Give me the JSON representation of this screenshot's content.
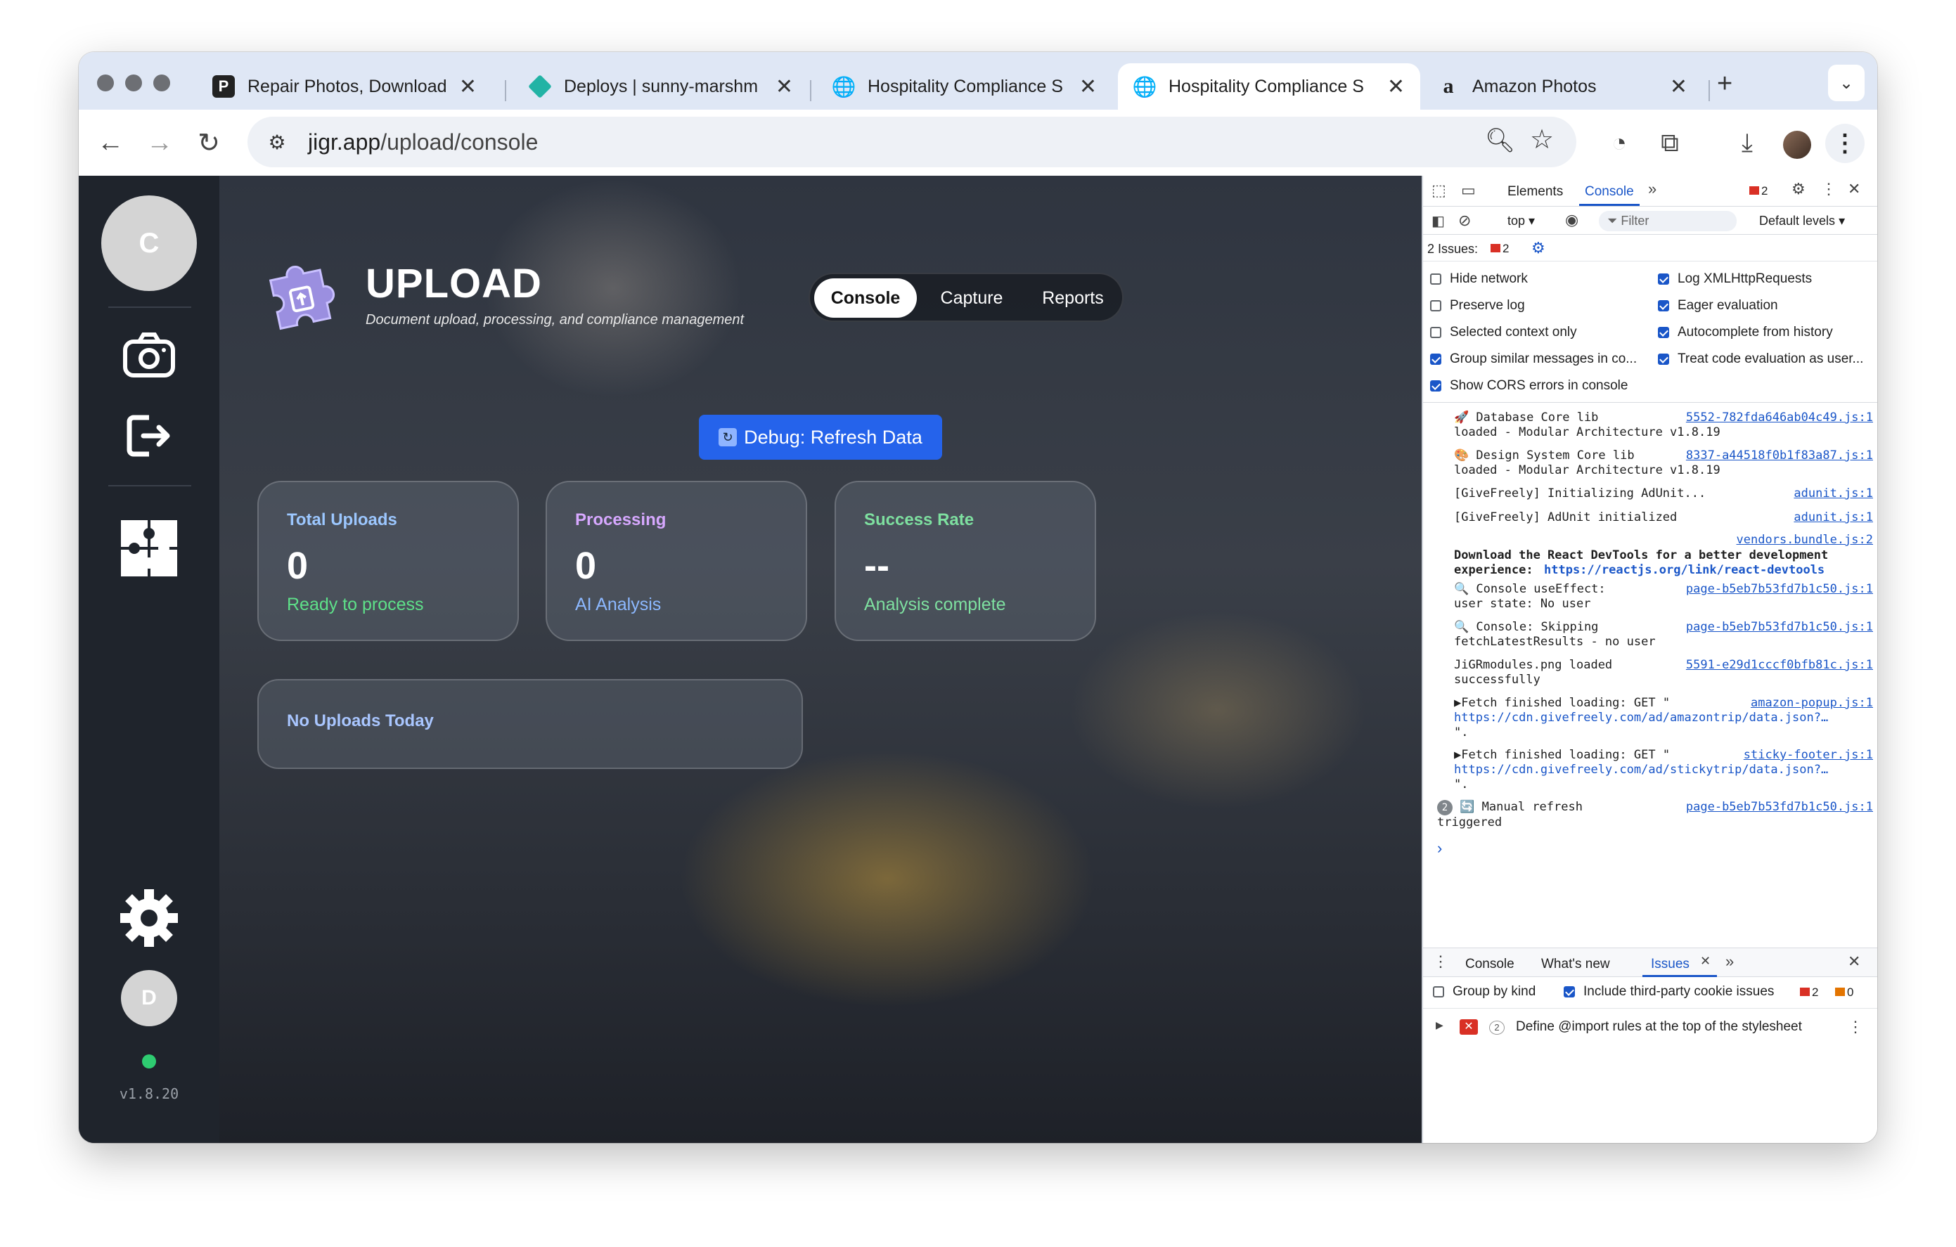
{
  "browser": {
    "tabs": [
      {
        "title": "Repair Photos, Download",
        "favicon": "p-logo-icon",
        "active": false
      },
      {
        "title": "Deploys | sunny-marshm",
        "favicon": "netlify-diamond-icon",
        "active": false
      },
      {
        "title": "Hospitality Compliance S",
        "favicon": "globe-icon",
        "active": false
      },
      {
        "title": "Hospitality Compliance S",
        "favicon": "globe-icon",
        "active": true
      },
      {
        "title": "Amazon Photos",
        "favicon": "amazon-icon",
        "active": false
      }
    ],
    "url_domain": "jigr.app",
    "url_path": "/upload/console"
  },
  "app": {
    "sidebar_avatar": "C",
    "user_avatar": "D",
    "version": "v1.8.20",
    "title": "UPLOAD",
    "subtitle": "Document upload, processing, and compliance management",
    "nav": [
      "Console",
      "Capture",
      "Reports"
    ],
    "active_nav": "Console",
    "debug_button": "Debug: Refresh Data",
    "cards": [
      {
        "label": "Total Uploads",
        "value": "0",
        "sub": "Ready to process",
        "label_color": "#9cc7ff",
        "sub_color": "#5ee089"
      },
      {
        "label": "Processing",
        "value": "0",
        "sub": "AI Analysis",
        "label_color": "#d7a8ff",
        "sub_color": "#8cb8ff"
      },
      {
        "label": "Success Rate",
        "value": "--",
        "sub": "Analysis complete",
        "label_color": "#7ee0a0",
        "sub_color": "#7ee0a0"
      }
    ],
    "today_card": "No Uploads Today",
    "status_color": "#2ecc71"
  },
  "devtools": {
    "tabs": [
      "Elements",
      "Console"
    ],
    "active_tab": "Console",
    "error_count": "2",
    "context": "top",
    "filter_placeholder": "Filter",
    "levels": "Default levels",
    "issues_label": "2 Issues:",
    "issues_count": "2",
    "settings": [
      {
        "label": "Hide network",
        "checked": false
      },
      {
        "label": "Log XMLHttpRequests",
        "checked": true
      },
      {
        "label": "Preserve log",
        "checked": false
      },
      {
        "label": "Eager evaluation",
        "checked": true
      },
      {
        "label": "Selected context only",
        "checked": false
      },
      {
        "label": "Autocomplete from history",
        "checked": true
      },
      {
        "label": "Group similar messages in co...",
        "checked": true
      },
      {
        "label": "Treat code evaluation as user...",
        "checked": true
      },
      {
        "label": "Show CORS errors in console",
        "checked": true
      }
    ],
    "logs": [
      {
        "prefix": "🚀",
        "lines": "Database Core lib\nloaded - Modular Architecture v1.8.19",
        "source": "5552-782fda646ab04c49.js:1"
      },
      {
        "prefix": "🎨",
        "lines": "Design System Core lib\nloaded - Modular Architecture v1.8.19",
        "source": "8337-a44518f0b1f83a87.js:1"
      },
      {
        "prefix": "",
        "lines": "[GiveFreely] Initializing AdUnit...",
        "source": "adunit.js:1"
      },
      {
        "prefix": "",
        "lines": "[GiveFreely] AdUnit initialized",
        "source": "adunit.js:1"
      },
      {
        "prefix": "",
        "lines": "",
        "source": "vendors.bundle.js:2"
      },
      {
        "prefix": "",
        "lines": "Download the React DevTools for a better development\nexperience:",
        "link": "https://reactjs.org/link/react-devtools",
        "source": ""
      },
      {
        "prefix": "🔍",
        "lines": "Console useEffect:\nuser state: No user",
        "source": "page-b5eb7b53fd7b1c50.js:1"
      },
      {
        "prefix": "🔍",
        "lines": "Console: Skipping\nfetchLatestResults - no user",
        "source": "page-b5eb7b53fd7b1c50.js:1"
      },
      {
        "prefix": "",
        "lines": "JiGRmodules.png loaded\nsuccessfully",
        "source": "5591-e29d1cccf0bfb81c.js:1"
      },
      {
        "prefix": "▶",
        "lines": "Fetch finished loading: GET \"",
        "link": "https://cdn.givefreely.com/ad/amazontrip/data.json?…",
        "tail": "\".",
        "source": "amazon-popup.js:1"
      },
      {
        "prefix": "▶",
        "lines": "Fetch finished loading: GET \"",
        "link": "https://cdn.givefreely.com/ad/stickytrip/data.json?…",
        "tail": "\".",
        "source": "sticky-footer.js:1"
      },
      {
        "prefix": "🔄",
        "count": "2",
        "lines": "Manual refresh\ntriggered",
        "source": "page-b5eb7b53fd7b1c50.js:1"
      }
    ],
    "drawer_tabs": [
      "Console",
      "What's new",
      "Issues"
    ],
    "drawer_active": "Issues",
    "drawer_options": [
      {
        "label": "Group by kind",
        "checked": false
      },
      {
        "label": "Include third-party cookie issues",
        "checked": true
      }
    ],
    "drawer_errors": "2",
    "drawer_warnings": "0",
    "issue_count": "2",
    "issue_text": "Define @import rules at the top of the stylesheet"
  }
}
